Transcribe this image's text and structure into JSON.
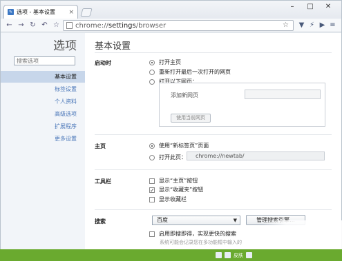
{
  "window": {
    "tab_title": "选项 - 基本设置",
    "tab_close": "×",
    "minimize": "–",
    "maximize": "□",
    "close": "✕"
  },
  "toolbar": {
    "back": "←",
    "forward": "→",
    "reload": "↻",
    "undo": "↶",
    "star": "☆",
    "url_scheme": "chrome://",
    "url_host": "settings",
    "url_path": "/browser",
    "omni_star": "☆",
    "menu_icon": "▼",
    "bolt": "⚡",
    "play": "▶",
    "wrench": "≡"
  },
  "sidebar": {
    "heading": "选项",
    "search_placeholder": "搜索选项",
    "items": [
      {
        "label": "基本设置",
        "active": true
      },
      {
        "label": "标签设置",
        "active": false
      },
      {
        "label": "个人资料",
        "active": false
      },
      {
        "label": "高级选项",
        "active": false
      },
      {
        "label": "扩展程序",
        "active": false
      },
      {
        "label": "更多设置",
        "active": false
      }
    ]
  },
  "content": {
    "title": "基本设置",
    "startup": {
      "label": "启动时",
      "opt1": "打开主页",
      "opt2": "重新打开最后一次打开的网页",
      "opt3": "打开以下网页：",
      "add_new_page": "添加新网页",
      "use_current": "使用当前网页"
    },
    "home": {
      "label": "主页",
      "opt1": "使用“新标签页”页面",
      "opt2": "打开此页：",
      "url": "chrome://newtab/"
    },
    "toolbar_section": {
      "label": "工具栏",
      "show_home": "显示“主页”按钮",
      "show_bookmarks_btn": "显示“收藏夹”按钮",
      "show_bookmarks_bar": "显示收藏栏",
      "checkmark": "✓"
    },
    "search": {
      "label": "搜索",
      "engine": "百度",
      "manage_button": "管理搜索引擎...",
      "instant_label": "启用即搜即得，实现更快的搜索",
      "instant_desc": "系统可能会记录您在多功能框中输入的"
    }
  },
  "taskbar": {
    "tray_label": "皮肤"
  }
}
